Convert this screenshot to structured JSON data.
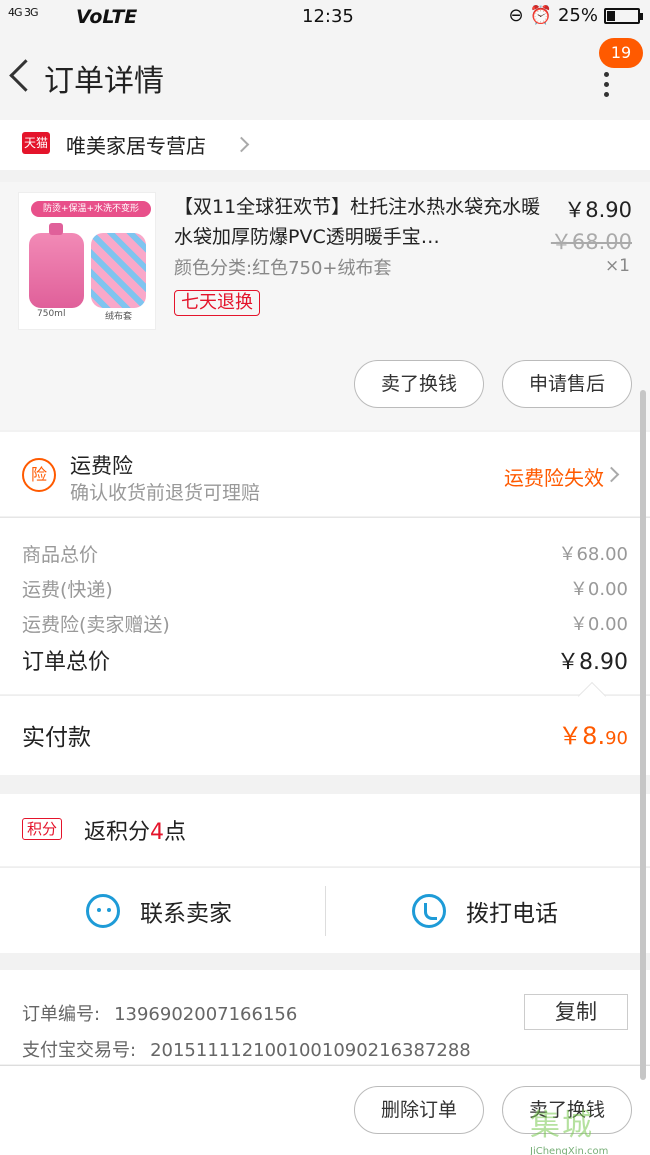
{
  "status_bar": {
    "signal": "4G 3G",
    "network": "VoLTE",
    "time": "12:35",
    "battery": "25%",
    "battery_level": 0.25
  },
  "nav": {
    "title": "订单详情",
    "badge": "19"
  },
  "store": {
    "tag": "天猫",
    "name": "唯美家居专营店"
  },
  "product": {
    "image_banner": "防烫+保温+水洗不变形",
    "image_caption_left": "750ml",
    "image_caption_right": "绒布套",
    "title": "【双11全球狂欢节】杜托注水热水袋充水暖水袋加厚防爆PVC透明暖手宝…",
    "variant": "颜色分类:红色750+绒布套",
    "tag": "七天退换",
    "price": "￥8.90",
    "original_price": "￥68.00",
    "quantity": "×1",
    "btn_sell": "卖了换钱",
    "btn_aftersale": "申请售后"
  },
  "insurance": {
    "icon": "险",
    "title": "运费险",
    "subtitle": "确认收货前退货可理赔",
    "status": "运费险失效"
  },
  "pricing": {
    "rows": [
      {
        "label": "商品总价",
        "value": "￥68.00"
      },
      {
        "label": "运费(快递)",
        "value": "￥0.00"
      },
      {
        "label": "运费险(卖家赠送)",
        "value": "￥0.00"
      }
    ],
    "total_label": "订单总价",
    "total_value": "￥8.90"
  },
  "paid": {
    "label": "实付款",
    "value_main": "￥8.",
    "value_cents": "90"
  },
  "points": {
    "icon": "积分",
    "prefix": "返积分",
    "num": "4",
    "suffix": "点"
  },
  "contact": {
    "seller": "联系卖家",
    "call": "拨打电话"
  },
  "order_info": {
    "order_no_label": "订单编号:",
    "order_no": "1396902007166156",
    "alipay_label": "支付宝交易号:",
    "alipay_no": "2015111121001001090216387288",
    "copy": "复制"
  },
  "bottom": {
    "delete": "删除订单",
    "sell": "卖了换钱"
  },
  "watermark": {
    "text": "集城",
    "site": "JiChengXin.com"
  },
  "colors": {
    "accent": "#ff5a00",
    "tmall_red": "#e4142b",
    "blue": "#1e9bd7"
  }
}
